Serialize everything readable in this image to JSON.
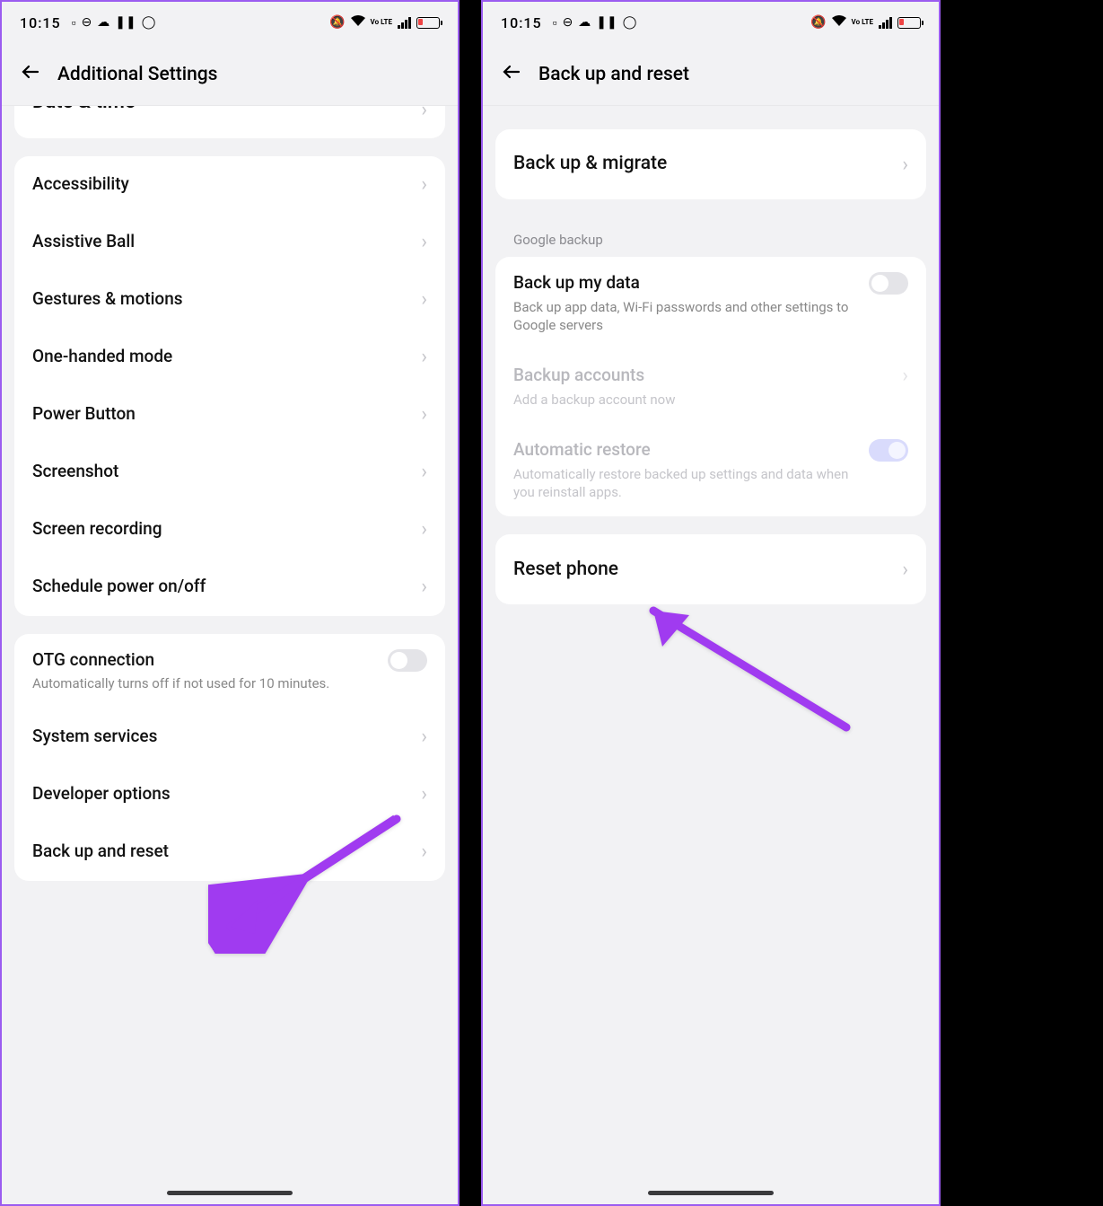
{
  "status": {
    "time": "10:15",
    "lte_label": "Vo LTE"
  },
  "left": {
    "title": "Additional Settings",
    "cut_item": "Date & time",
    "group1": [
      "Accessibility",
      "Assistive Ball",
      "Gestures & motions",
      "One-handed mode",
      "Power Button",
      "Screenshot",
      "Screen recording",
      "Schedule power on/off"
    ],
    "otg": {
      "title": "OTG connection",
      "sub": "Automatically turns off if not used for 10 minutes."
    },
    "group2": [
      "System services",
      "Developer options",
      "Back up and reset"
    ]
  },
  "right": {
    "title": "Back up and reset",
    "backup_migrate": "Back up & migrate",
    "section_label": "Google backup",
    "backup_my_data": {
      "title": "Back up my data",
      "sub": "Back up app data, Wi-Fi passwords and other settings to Google servers"
    },
    "backup_accounts": {
      "title": "Backup accounts",
      "sub": "Add a backup account now"
    },
    "automatic_restore": {
      "title": "Automatic restore",
      "sub": "Automatically restore backed up settings and data when you reinstall apps."
    },
    "reset_phone": "Reset phone"
  }
}
